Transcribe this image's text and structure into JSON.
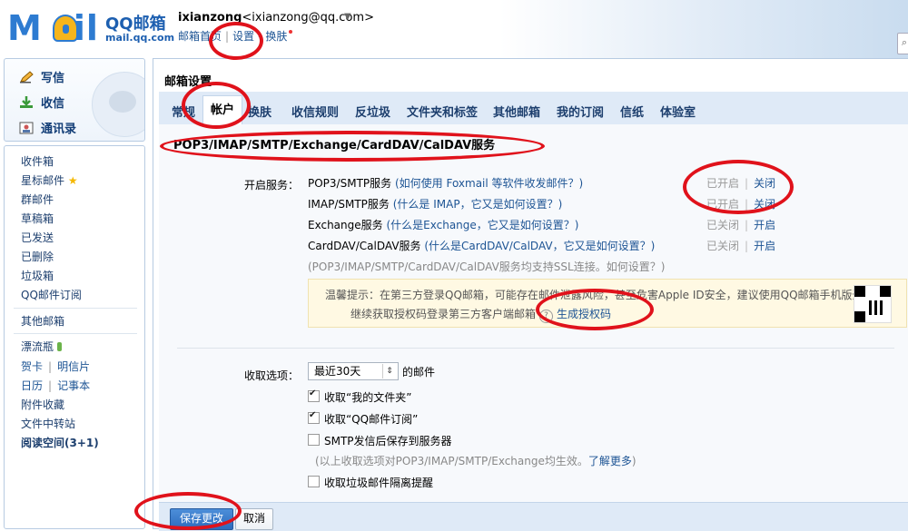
{
  "header": {
    "logo_word": "M",
    "logo_word_tail": "il",
    "logo_cn": "QQ邮箱",
    "logo_url": "mail.qq.com",
    "user_name": "ixianzong",
    "user_email": "<ixianzong@qq.com>",
    "caret": "▼",
    "links": [
      "邮箱首页",
      "设置",
      "换肤"
    ]
  },
  "leftnav": {
    "main": [
      {
        "label": "写信",
        "icon": "pen-icon"
      },
      {
        "label": "收信",
        "icon": "download-icon"
      },
      {
        "label": "通讯录",
        "icon": "contacts-icon"
      }
    ],
    "folders": [
      "收件箱",
      "星标邮件",
      "群邮件",
      "草稿箱",
      "已发送",
      "已删除",
      "垃圾箱",
      "QQ邮件订阅"
    ],
    "other": "其他邮箱",
    "extras": {
      "bottle": "漂流瓶",
      "card": "贺卡",
      "postcard": "明信片",
      "calendar": "日历",
      "notes": "记事本",
      "attachments": "附件收藏",
      "transfer": "文件中转站",
      "reading": "阅读空间(3+1)"
    }
  },
  "main": {
    "title": "邮箱设置",
    "tabs": [
      "常规",
      "帐户",
      "换肤",
      "收信规则",
      "反垃圾",
      "文件夹和标签",
      "其他邮箱",
      "我的订阅",
      "信纸",
      "体验室"
    ],
    "active_tab": "帐户",
    "section_title": "POP3/IMAP/SMTP/Exchange/CardDAV/CalDAV服务",
    "service_label": "开启服务：",
    "services": [
      {
        "name": "POP3/SMTP服务",
        "hint": "(如何使用 Foxmail 等软件收发邮件？)",
        "state": "已开启",
        "action": "关闭"
      },
      {
        "name": "IMAP/SMTP服务",
        "hint": "(什么是 IMAP，它又是如何设置？)",
        "state": "已开启",
        "action": "关闭"
      },
      {
        "name": "Exchange服务",
        "hint": "(什么是Exchange，它又是如何设置？)",
        "state": "已关闭",
        "action": "开启"
      },
      {
        "name": "CardDAV/CalDAV服务",
        "hint": "(什么是CardDAV/CalDAV，它又是如何设置？)",
        "state": "已关闭",
        "action": "开启"
      }
    ],
    "ssl_note": "(POP3/IMAP/SMTP/CardDAV/CalDAV服务均支持SSL连接。如何设置？)",
    "tip_line1": "温馨提示：在第三方登录QQ邮箱，可能存在邮件泄露风险，甚至危害Apple ID安全，建议使用QQ邮箱手机版登录。",
    "tip_line2_prefix": "继续获取授权码登录第三方客户端邮箱",
    "tip_q": "?",
    "tip_link": "生成授权码",
    "fetch_label": "收取选项：",
    "fetch_select": "最近30天",
    "fetch_suffix": "的邮件",
    "options": [
      {
        "label": "收取“我的文件夹”",
        "checked": true
      },
      {
        "label": "收取“QQ邮件订阅”",
        "checked": true
      },
      {
        "label": "SMTP发信后保存到服务器",
        "checked": false
      }
    ],
    "fetch_note_prefix": "(以上收取选项对POP3/IMAP/SMTP/Exchange均生效。",
    "fetch_note_link": "了解更多",
    "fetch_note_suffix": ")",
    "junk_option": {
      "label": "收取垃圾邮件隔离提醒",
      "checked": false
    },
    "save_label": "保存更改",
    "cancel_label": "取消"
  },
  "colors": {
    "accent": "#2d6bbd",
    "annotation": "#e0121b",
    "tab_bar": "#dfeaf7"
  }
}
